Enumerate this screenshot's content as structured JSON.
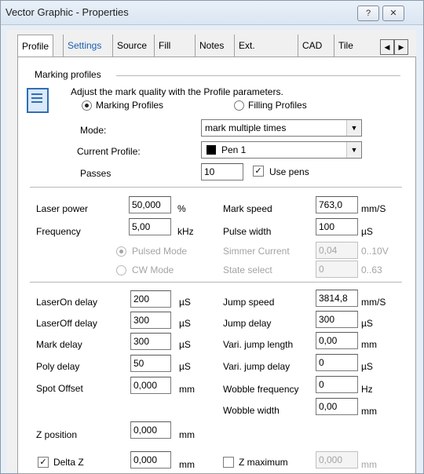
{
  "window": {
    "title": "Vector Graphic - Properties",
    "help_glyph": "?",
    "close_glyph": "✕"
  },
  "tabs": [
    "Profile",
    "Settings",
    "Source",
    "Fill",
    "Notes",
    "Ext. Control",
    "CAD",
    "Tile"
  ],
  "tab_scroll": {
    "left": "◀",
    "right": "▶"
  },
  "profiles": {
    "group_label": "Marking profiles",
    "hint": "Adjust the mark quality with the Profile parameters.",
    "radio_marking": "Marking Profiles",
    "radio_filling": "Filling Profiles",
    "mode_label": "Mode:",
    "mode_value": "mark multiple times",
    "current_profile_label": "Current Profile:",
    "current_profile_value": "Pen 1",
    "passes_label": "Passes",
    "passes_value": "10",
    "use_pens_label": "Use pens"
  },
  "laser": {
    "power_label": "Laser power",
    "power_value": "50,000",
    "power_unit": "%",
    "frequency_label": "Frequency",
    "frequency_value": "5,00",
    "frequency_unit": "kHz",
    "mark_speed_label": "Mark speed",
    "mark_speed_value": "763,0",
    "mark_speed_unit": "mm/S",
    "pulse_width_label": "Pulse width",
    "pulse_width_value": "100",
    "pulse_width_unit": "µS",
    "pulsed_mode_label": "Pulsed Mode",
    "cw_mode_label": "CW Mode",
    "simmer_label": "Simmer Current",
    "simmer_value": "0,04",
    "simmer_range": "0..10V",
    "state_label": "State select",
    "state_value": "0",
    "state_range": "0..63"
  },
  "timing": {
    "laseron_label": "LaserOn delay",
    "laseron_value": "200",
    "laseron_unit": "µS",
    "laseroff_label": "LaserOff delay",
    "laseroff_value": "300",
    "laseroff_unit": "µS",
    "mark_delay_label": "Mark delay",
    "mark_delay_value": "300",
    "mark_delay_unit": "µS",
    "poly_delay_label": "Poly delay",
    "poly_delay_value": "50",
    "poly_delay_unit": "µS",
    "spot_offset_label": "Spot Offset",
    "spot_offset_value": "0,000",
    "spot_offset_unit": "mm",
    "jump_speed_label": "Jump speed",
    "jump_speed_value": "3814,8",
    "jump_speed_unit": "mm/S",
    "jump_delay_label": "Jump delay",
    "jump_delay_value": "300",
    "jump_delay_unit": "µS",
    "vari_len_label": "Vari. jump length",
    "vari_len_value": "0,00",
    "vari_len_unit": "mm",
    "vari_delay_label": "Vari. jump delay",
    "vari_delay_value": "0",
    "vari_delay_unit": "µS",
    "wobble_freq_label": "Wobble frequency",
    "wobble_freq_value": "0",
    "wobble_freq_unit": "Hz",
    "wobble_width_label": "Wobble width",
    "wobble_width_value": "0,00",
    "wobble_width_unit": "mm"
  },
  "z": {
    "zpos_label": "Z position",
    "zpos_value": "0,000",
    "zpos_unit": "mm",
    "delta_label": "Delta Z",
    "delta_value": "0,000",
    "delta_unit": "mm",
    "zmax_label": "Z maximum",
    "zmax_value": "0,000",
    "zmax_unit": "mm"
  },
  "checks": {
    "use_pens": "✓",
    "delta_z": "✓"
  }
}
